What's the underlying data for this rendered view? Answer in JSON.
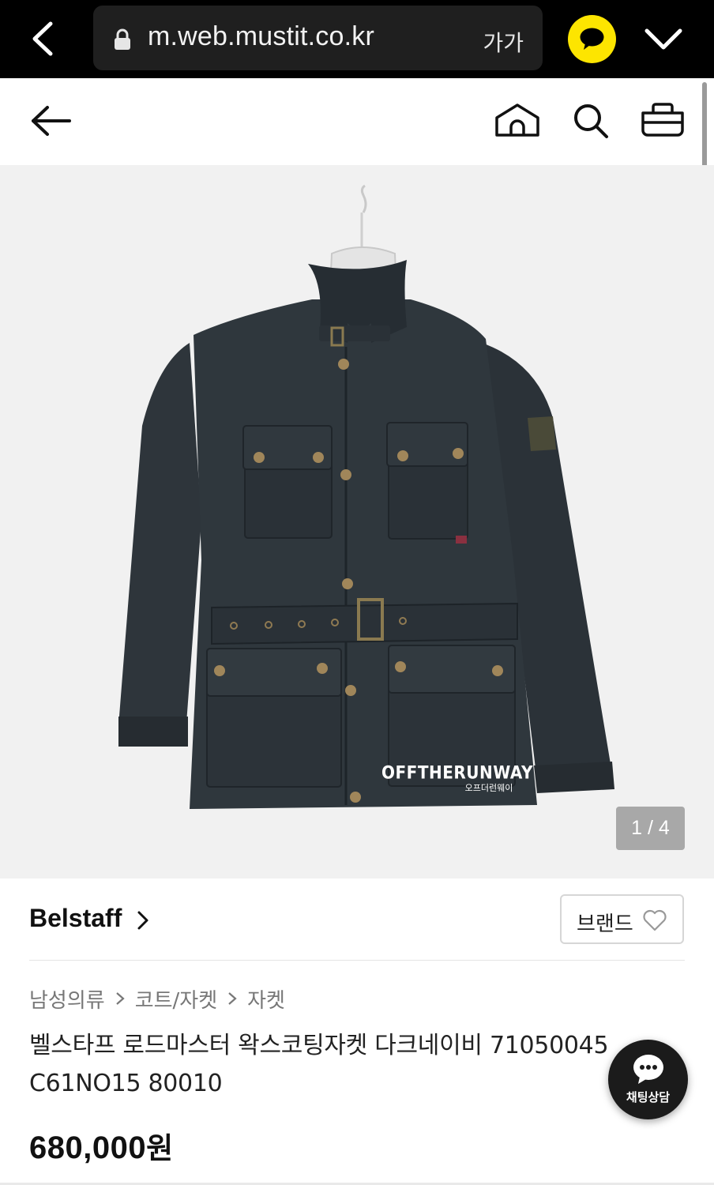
{
  "browser": {
    "url": "m.web.mustit.co.kr",
    "text_size_label": "가가",
    "icons": [
      "back-chevron-icon",
      "lock-icon",
      "kakaotalk-icon",
      "chevron-down-icon"
    ]
  },
  "header": {
    "icons": [
      "arrow-left-icon",
      "home-icon",
      "search-icon",
      "cart-icon"
    ]
  },
  "gallery": {
    "watermark_main": "OFFTHERUNWAY",
    "watermark_sub": "오프더런웨이",
    "pager": "1 / 4",
    "current_index": 1,
    "total": 4
  },
  "brand": {
    "name": "Belstaff",
    "favorite_label": "브랜드",
    "icons": [
      "chevron-right-icon",
      "heart-icon"
    ]
  },
  "breadcrumb": [
    "남성의류",
    "코트/자켓",
    "자켓"
  ],
  "product": {
    "title_line1": "벨스타프 로드마스터 왁스코팅자켓 다크네이비 71050045",
    "title_line2": "C61NO15 80010",
    "price": "680,000",
    "price_unit": "원"
  },
  "chat": {
    "label": "채팅상담",
    "icon": "chat-bubble-icon"
  },
  "colors": {
    "browser_bg": "#000000",
    "kakao_yellow": "#fde500",
    "image_bg": "#f1f1f1",
    "jacket": "#2b3238",
    "text_primary": "#111111",
    "text_secondary": "#777777"
  }
}
